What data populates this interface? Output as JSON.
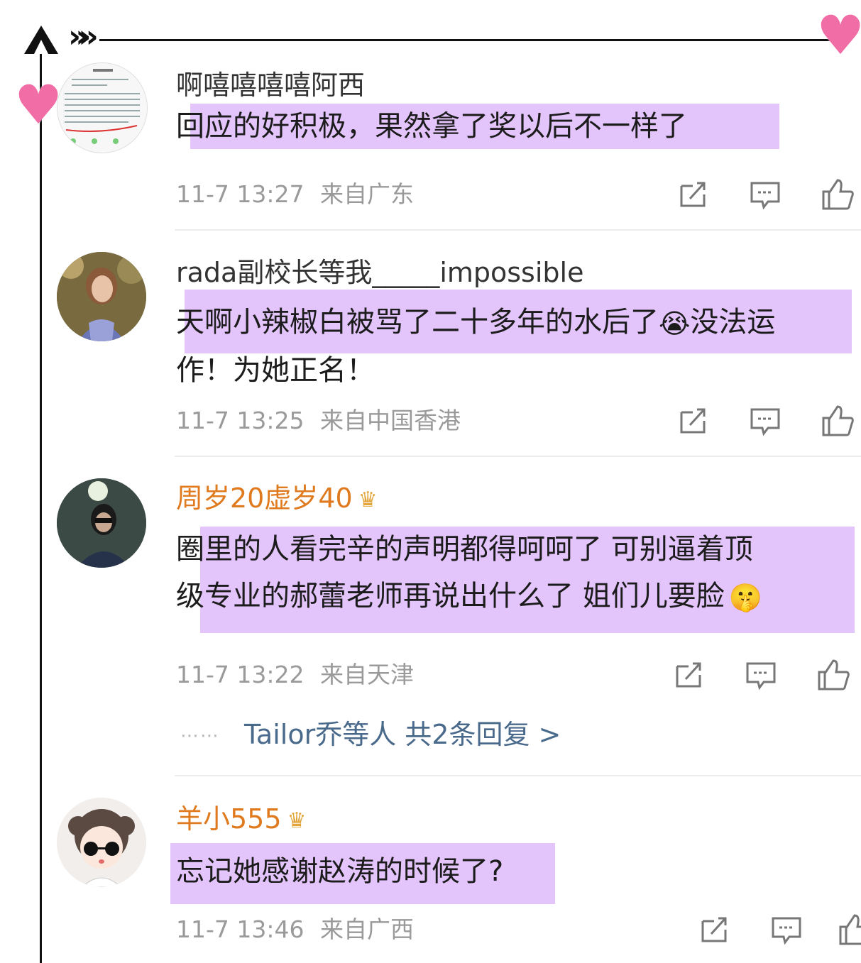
{
  "decor": {
    "arrow_icon": "arrow-up-icon",
    "chevrons": "»»",
    "heart_icon": "heart-icon",
    "heart": "♥"
  },
  "comments": [
    {
      "username": "啊嘻嘻嘻嘻阿西",
      "name_color": "#333333",
      "text_line1": "回应的好积极，果然拿了奖以后不一样了",
      "text_line2": "",
      "time": "11-7 13:27",
      "location": "来自广东",
      "avatar_icon": "weibo-screenshot-avatar"
    },
    {
      "username": "rada副校长等我_____impossible",
      "name_color": "#333333",
      "text_line1": "天啊小辣椒白被骂了二十多年的水后了",
      "emoji1": "😭",
      "text_line1_tail": "没法运",
      "text_line2": "作！为她正名！",
      "time": "11-7 13:25",
      "location": "来自中国香港",
      "avatar_icon": "woman-photo-avatar"
    },
    {
      "username": "周岁20虚岁40",
      "badge_icon": "crown-badge-icon",
      "name_color": "#e07a1e",
      "text_line1": "圈里的人看完辛的声明都得呵呵了 可别逼着顶",
      "text_line2": "级专业的郝蕾老师再说出什么了 姐们儿要脸",
      "emoji2": "🤫",
      "time": "11-7 13:22",
      "location": "来自天津",
      "avatar_icon": "person-photo-avatar",
      "replies": {
        "dots": "⋯⋯",
        "label": "Tailor乔等人 共2条回复 >"
      }
    },
    {
      "username": "羊小555",
      "badge_icon": "crown-badge-icon",
      "name_color": "#e07a1e",
      "text_line1": "忘记她感谢赵涛的时候了?",
      "text_line2": "",
      "time": "11-7 13:46",
      "location": "来自广西",
      "avatar_icon": "cartoon-girl-avatar"
    }
  ],
  "actions": {
    "share_icon": "share-icon",
    "comment_icon": "comment-icon",
    "like_icon": "like-icon"
  }
}
